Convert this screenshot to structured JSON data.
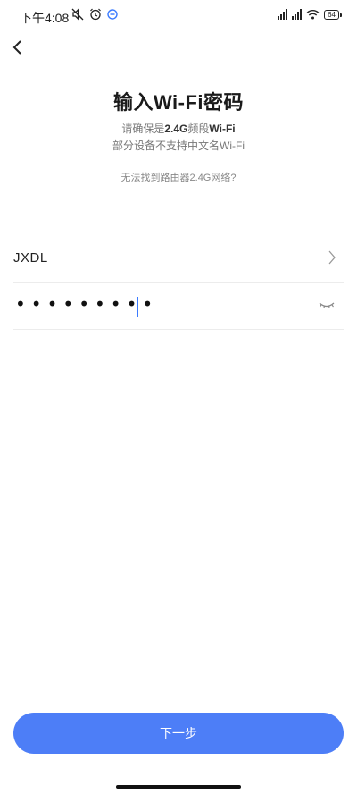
{
  "status_bar": {
    "time": "下午4:08",
    "battery": "64",
    "icons_left": [
      "mute-icon",
      "alarm-icon",
      "app-notification-icon"
    ],
    "icons_right": [
      "signal-icon",
      "signal-icon",
      "wifi-icon",
      "battery-icon"
    ]
  },
  "nav": {
    "back_icon": "back-arrow-icon"
  },
  "header": {
    "title": "输入Wi-Fi密码",
    "subtitle_line1_prefix": "请确保是",
    "subtitle_line1_bold": "2.4G",
    "subtitle_line1_middle": "频段",
    "subtitle_line1_suffix": "Wi-Fi",
    "subtitle_line2": "部分设备不支持中文名Wi-Fi",
    "help_link": "无法找到路由器2.4G网络?"
  },
  "form": {
    "ssid": "JXDL",
    "password_masked": "•••••••••",
    "password_length": 9,
    "ssid_icon": "chevron-right-icon",
    "visibility_icon": "eye-closed-icon"
  },
  "footer": {
    "next_label": "下一步",
    "accent_color": "#4d7ef7"
  }
}
